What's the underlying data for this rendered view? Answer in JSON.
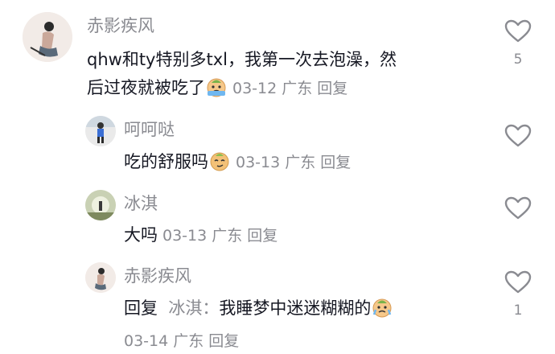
{
  "comments": [
    {
      "username": "赤影疾风",
      "text": "qhw和ty特别多txl，我第一次去泡澡，然",
      "text_line2": "后过夜就被吃了",
      "emoji": "crying-face",
      "date": "03-12",
      "location": "广东",
      "reply_label": "回复",
      "likes": "5"
    },
    {
      "username": "呵呵哒",
      "text": "吃的舒服吗",
      "emoji": "smirk-face",
      "date": "03-13",
      "location": "广东",
      "reply_label": "回复",
      "likes": ""
    },
    {
      "username": "冰淇",
      "text": "大吗",
      "date": "03-13",
      "location": "广东",
      "reply_label": "回复",
      "likes": ""
    },
    {
      "username": "赤影疾风",
      "reply_prefix": "回复",
      "reply_to": "冰淇：",
      "text": "我睡梦中迷迷糊糊的",
      "emoji": "crying-face",
      "date": "03-14",
      "location": "广东",
      "reply_label": "回复",
      "likes": "1"
    }
  ],
  "colors": {
    "text": "#161823",
    "secondary": "#8a8b91",
    "heart_outline": "#8a8b91"
  }
}
